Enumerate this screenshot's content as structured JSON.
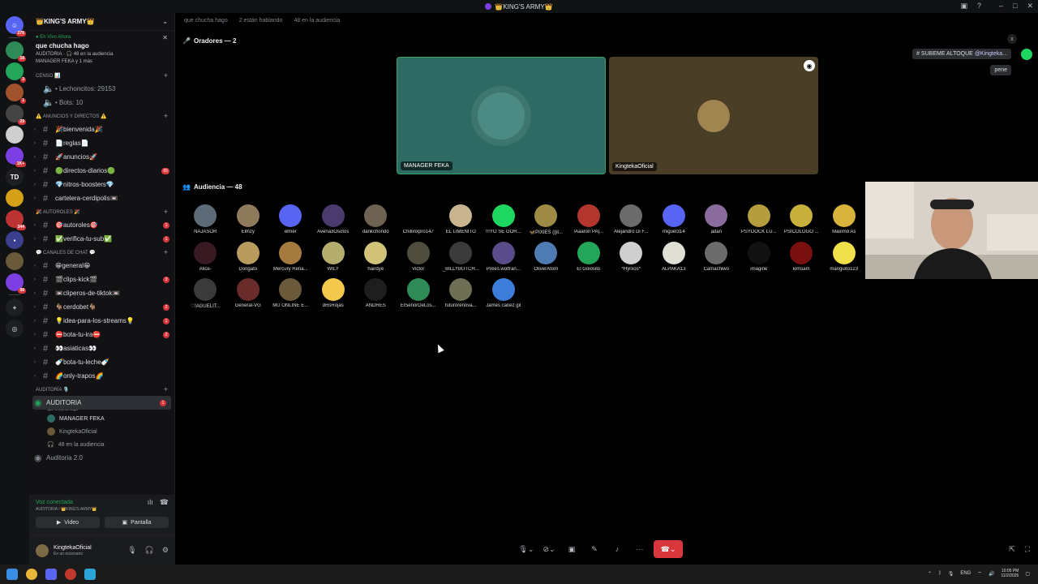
{
  "window": {
    "title": "👑KING'S ARMY👑"
  },
  "server": {
    "name": "👑KING'S ARMY👑"
  },
  "live": {
    "badge": "En Vivo Ahora",
    "topic": "que chucha hago",
    "meta": "AUDITORIA · 🎧 48 en la audiencia",
    "people": "MANAGER FEKA y 1 más"
  },
  "rail": {
    "badges": [
      "276",
      "18",
      "3",
      "1",
      "29",
      "",
      "1K+",
      "",
      "344",
      "",
      "98"
    ],
    "td_label": "TD"
  },
  "categories": {
    "censo": "CENSO 📊",
    "anuncios": "⚠️ ANUNCIOS Y DIRECTOS ⚠️",
    "autoroles": "🎉 AUTOROLES 🎉",
    "canales": "💬 CANALES DE CHAT 💬",
    "auditoria": "AUDITORÍA 🎙️"
  },
  "censo_items": [
    "• Lechoncitos: 29153",
    "• Bots: 10"
  ],
  "anuncios_items": [
    {
      "label": "🎉bienvenida🎉",
      "count": ""
    },
    {
      "label": "📄reglas📄",
      "count": ""
    },
    {
      "label": "🚀anuncios🚀",
      "count": ""
    },
    {
      "label": "🟢directos-diarios🟢",
      "count": "65"
    },
    {
      "label": "💎nitros-boosters💎",
      "count": ""
    },
    {
      "label": "cartelera-cerdipolis📼",
      "count": ""
    }
  ],
  "autoroles_items": [
    {
      "label": "🎯autoroles🎯",
      "count": "1"
    },
    {
      "label": "✅verifica-tu-sub✅",
      "count": "1"
    }
  ],
  "canales_items": [
    {
      "label": "😁general😁",
      "count": ""
    },
    {
      "label": "🎬clips-kick🎬",
      "count": "3"
    },
    {
      "label": "📼cliperos-de-tiktok📼",
      "count": ""
    },
    {
      "label": "🐐cerdobet🐐",
      "count": "2"
    },
    {
      "label": "💡idea-para-los-streams💡",
      "count": "1"
    },
    {
      "label": "⛔bota-tu-ira⛔",
      "count": "2"
    },
    {
      "label": "👀asiaticas👀",
      "count": ""
    },
    {
      "label": "🍼bota-tu-leche🍼",
      "count": ""
    },
    {
      "label": "🌈only-trapos🌈",
      "count": ""
    }
  ],
  "auditoria": {
    "channel": "AUDITORIA",
    "count": "1",
    "sub": "que chucha hago",
    "users": [
      "MANAGER FEKA",
      "KingtekaOficial"
    ],
    "audience": "48 en la audiencia",
    "channel2": "Auditoria 2.0"
  },
  "voice": {
    "status": "Voz conectada",
    "location": "AUDITORIA / 👑KING'S ARMY👑",
    "video": "Video",
    "screen": "Pantalla"
  },
  "user": {
    "name": "KingtekaOficial",
    "status": "En un escenario"
  },
  "stage": {
    "topic": "que chucha hago",
    "speaking": "2 están hablando",
    "audience_count": "48 en la audiencia",
    "speakers_header": "Oradores — 2",
    "audience_header": "Audiencia — 48",
    "speakers": [
      {
        "name": "MANAGER FEKA",
        "color": "#2d6a63"
      },
      {
        "name": "KingtekaOficial",
        "color": "#4a3e27"
      }
    ]
  },
  "audience": [
    {
      "name": "NAJASOR",
      "color": "#5d6a78"
    },
    {
      "name": "Elmzy",
      "color": "#8d7b5c"
    },
    {
      "name": "elmer",
      "color": "#5865f2"
    },
    {
      "name": "Avena3Osotos",
      "color": "#4b3a6e"
    },
    {
      "name": "dankchondo",
      "color": "#6e6252"
    },
    {
      "name": "Chillinxpro147",
      "color": "#000000"
    },
    {
      "name": "EL LIMEÑITO",
      "color": "#c8b590"
    },
    {
      "name": "!!!YO SE GOR...",
      "color": "#1ed760"
    },
    {
      "name": "🦋PIXIES (||il...",
      "color": "#9c8a45"
    },
    {
      "name": "!Aaaron PA|...",
      "color": "#b3362e"
    },
    {
      "name": "Alejandro Di F...",
      "color": "#6b6b6b"
    },
    {
      "name": "miguel314",
      "color": "#5865f2"
    },
    {
      "name": "adan",
      "color": "#8a6d9e"
    },
    {
      "name": "PSYDOCK LU...",
      "color": "#b59c3c"
    },
    {
      "name": "PSICOLOGO ...",
      "color": "#c7b13c"
    },
    {
      "name": "Maximo As",
      "color": "#d7b33c"
    },
    {
      "name": "Alice-",
      "color": "#3a1a22"
    },
    {
      "name": "Dongato",
      "color": "#b99a5f"
    },
    {
      "name": "Mercury Rena...",
      "color": "#a57a3f"
    },
    {
      "name": "WILY",
      "color": "#b5ad6e"
    },
    {
      "name": "hairdye",
      "color": "#d1c27a"
    },
    {
      "name": "Victor",
      "color": "#4f4c3c"
    },
    {
      "name": "_BILLYBUTCH...",
      "color": "#3b3a3a"
    },
    {
      "name": "Pixies.wolfran...",
      "color": "#5a4b8a"
    },
    {
      "name": "OliverAtom",
      "color": "#4f7bb3"
    },
    {
      "name": "El Golosito",
      "color": "#23a55a"
    },
    {
      "name": "*Hyrxos*",
      "color": "#cfcfcf"
    },
    {
      "name": "ALPAKA13",
      "color": "#e0dfd5"
    },
    {
      "name": "Camachiwo",
      "color": "#6b6b6b"
    },
    {
      "name": "imagine",
      "color": "#111111"
    },
    {
      "name": "kimsam",
      "color": "#7a0f0f"
    },
    {
      "name": "manguito123",
      "color": "#f0e04a"
    },
    {
      "name": "♡!AGUELIT...",
      "color": "#3a3a3a"
    },
    {
      "name": "General-VG",
      "color": "#6a2b2b"
    },
    {
      "name": "MU ONLINE E...",
      "color": "#6b5a3a"
    },
    {
      "name": "dRsRojas",
      "color": "#f2c94c"
    },
    {
      "name": "ANDRES",
      "color": "#1e1e1e"
    },
    {
      "name": "ElSeñorDeLos...",
      "color": "#2e8b57"
    },
    {
      "name": "futurorenova...",
      "color": "#6e6e55"
    },
    {
      "name": "James canez gil",
      "color": "#3b7dd8"
    }
  ],
  "notifications": {
    "subeme": "SUBEME ALTOQUE",
    "mention": "@Kingteka...",
    "pene": "pene",
    "close": "x"
  },
  "taskbar": {
    "lang": "ENG",
    "time": "10:05 PM",
    "date": "11/2/2025"
  }
}
